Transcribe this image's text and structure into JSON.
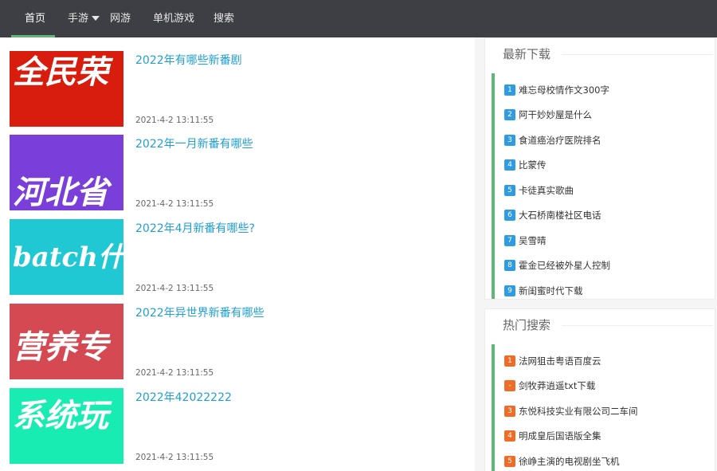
{
  "nav": {
    "items": [
      {
        "label": "首页",
        "active": true
      },
      {
        "label": "手游",
        "has_dropdown": true
      },
      {
        "label": "网游"
      },
      {
        "label": "单机游戏"
      },
      {
        "label": "搜索"
      }
    ]
  },
  "articles": [
    {
      "title": "2022年有哪些新番剧",
      "date": "2021-4-2 13:11:55",
      "thumb_text": "全民荣",
      "thumb_color": "#d81c0e"
    },
    {
      "title": "2022年一月新番有哪些",
      "date": "2021-4-2 13:11:55",
      "thumb_text": "河北省",
      "thumb_color": "#7a3fd8"
    },
    {
      "title": "2022年4月新番有哪些?",
      "date": "2021-4-2 13:11:55",
      "thumb_text": "batch什",
      "thumb_color": "#1fc8d2"
    },
    {
      "title": "2022年异世界新番有哪些",
      "date": "2021-4-2 13:11:55",
      "thumb_text": "营养专",
      "thumb_color": "#d54a52"
    },
    {
      "title": "2022年42022222",
      "date": "2021-4-2 13:11:55",
      "thumb_text": "系统玩",
      "thumb_color": "#18ecb2"
    }
  ],
  "latest_downloads": {
    "title": "最新下载",
    "items": [
      {
        "num": "1",
        "label": "难忘母校情作文300字"
      },
      {
        "num": "2",
        "label": "阿干妙妙屋是什么"
      },
      {
        "num": "3",
        "label": "食道癌治疗医院排名"
      },
      {
        "num": "4",
        "label": "比蒙传"
      },
      {
        "num": "5",
        "label": "卡徒真实歌曲"
      },
      {
        "num": "6",
        "label": "大石桥南楼社区电话"
      },
      {
        "num": "7",
        "label": "吴雪晴"
      },
      {
        "num": "8",
        "label": "霍金已经被外星人控制"
      },
      {
        "num": "9",
        "label": "新闺蜜时代下载"
      }
    ]
  },
  "hot_search": {
    "title": "热门搜索",
    "items": [
      {
        "num": "1",
        "label": "法网狙击粤语百度云"
      },
      {
        "num": "-",
        "label": "剑牧莽逍遥txt下载"
      },
      {
        "num": "3",
        "label": "东悦科技实业有限公司二车间"
      },
      {
        "num": "4",
        "label": "明成皇后国语版全集"
      },
      {
        "num": "5",
        "label": "徐峥主演的电视剧坐飞机"
      }
    ]
  },
  "colors": {
    "nav_bg": "#3e3f44",
    "accent_green": "#5fb878",
    "link_blue": "#1e9fd6",
    "badge_blue": "#2f9be0",
    "badge_orange": "#ee6c27"
  }
}
